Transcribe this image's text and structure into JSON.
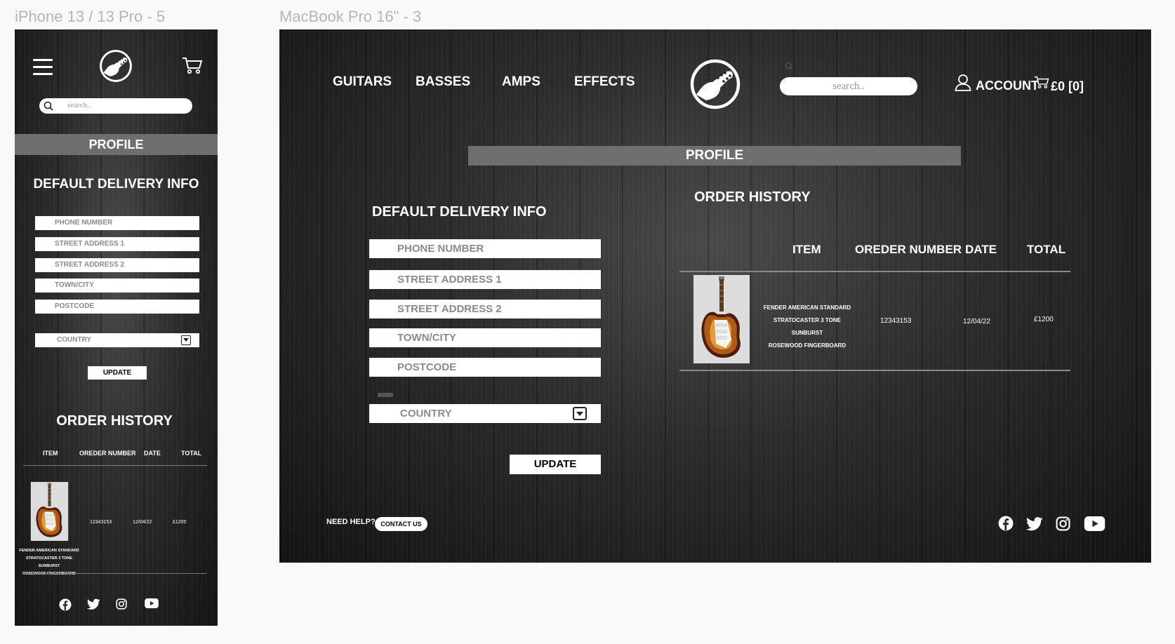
{
  "frames": {
    "mobile_title": "iPhone 13 / 13 Pro - 5",
    "desktop_title": "MacBook Pro 16\" - 3"
  },
  "nav": {
    "guitars": "GUITARS",
    "basses": "BASSES",
    "amps": "AMPS",
    "effects": "EFFECTS"
  },
  "search": {
    "placeholder": "search.."
  },
  "account": {
    "label": "ACCOUNT"
  },
  "cart": {
    "label": "£0 [0]"
  },
  "profile": {
    "title": "PROFILE"
  },
  "delivery": {
    "title": "DEFAULT DELIVERY INFO",
    "phone": "PHONE NUMBER",
    "street1": "STREET ADDRESS 1",
    "street2": "STREET ADDRESS 2",
    "town": "TOWN/CITY",
    "postcode": "POSTCODE",
    "country": "COUNTRY",
    "update": "UPDATE"
  },
  "order_history": {
    "title": "ORDER HISTORY",
    "columns": {
      "item": "ITEM",
      "order_number": "OREDER NUMBER",
      "date": "DATE",
      "total": "TOTAL"
    },
    "orders": [
      {
        "desc_line1": "FENDER AMERICAN STANDARD",
        "desc_line2": "STRATOCASTER 3 TONE SUNBURST",
        "desc_line3": "ROSEWOOD FINGERBOARD",
        "order_number": "12343153",
        "date": "12/04/22",
        "total": "£1200"
      }
    ]
  },
  "footer": {
    "need_help": "NEED HELP?",
    "contact": "CONTACT US"
  },
  "icons": {
    "menu": "hamburger-icon",
    "logo": "guitar-logo-icon",
    "cart": "cart-icon",
    "search": "search-icon",
    "account": "user-icon",
    "dropdown": "dropdown-arrow-icon",
    "facebook": "facebook-icon",
    "twitter": "twitter-icon",
    "instagram": "instagram-icon",
    "youtube": "youtube-icon"
  },
  "colors": {
    "bar": "#6e6e6e",
    "wood": "#232323",
    "text": "#ffffff"
  }
}
